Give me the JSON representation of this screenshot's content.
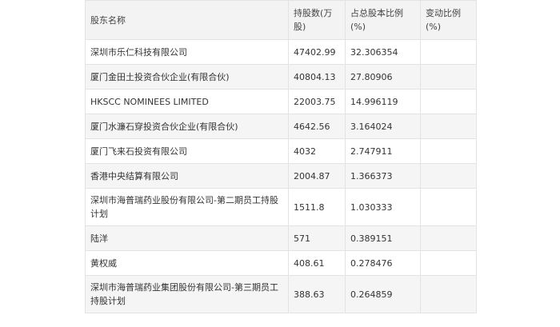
{
  "table": {
    "headers": [
      "股东名称",
      "持股数(万股)",
      "占总股本比例(%)",
      "变动比例(%)"
    ],
    "rows": [
      {
        "name": "深圳市乐仁科技有限公司",
        "shares": "47402.99",
        "ratio": "32.306354",
        "change": ""
      },
      {
        "name": "厦门金田土投资合伙企业(有限合伙)",
        "shares": "40804.13",
        "ratio": "27.80906",
        "change": ""
      },
      {
        "name": "HKSCC NOMINEES LIMITED",
        "shares": "22003.75",
        "ratio": "14.996119",
        "change": ""
      },
      {
        "name": "厦门水濂石穿投资合伙企业(有限合伙)",
        "shares": "4642.56",
        "ratio": "3.164024",
        "change": ""
      },
      {
        "name": "厦门飞来石投资有限公司",
        "shares": "4032",
        "ratio": "2.747911",
        "change": ""
      },
      {
        "name": "香港中央结算有限公司",
        "shares": "2004.87",
        "ratio": "1.366373",
        "change": ""
      },
      {
        "name": "深圳市海普瑞药业股份有限公司-第二期员工持股计划",
        "shares": "1511.8",
        "ratio": "1.030333",
        "change": ""
      },
      {
        "name": "陆洋",
        "shares": "571",
        "ratio": "0.389151",
        "change": ""
      },
      {
        "name": "黄权威",
        "shares": "408.61",
        "ratio": "0.278476",
        "change": ""
      },
      {
        "name": "深圳市海普瑞药业集团股份有限公司-第三期员工持股计划",
        "shares": "388.63",
        "ratio": "0.264859",
        "change": ""
      }
    ]
  }
}
